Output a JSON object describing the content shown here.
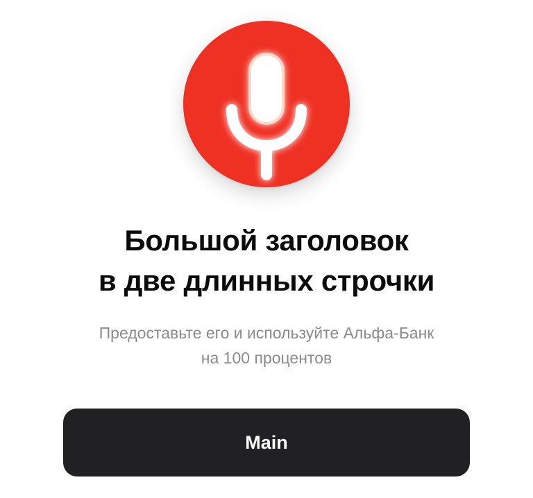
{
  "icon": {
    "name": "microphone-icon",
    "background_color": "#ef3124",
    "glyph_color": "#ffffff"
  },
  "title": {
    "line1": "Большой заголовок",
    "line2": "в две длинных строчки"
  },
  "subtitle": {
    "line1": "Предоставьте его и используйте Альфа-Банк",
    "line2": "на 100 процентов"
  },
  "button": {
    "label": "Main",
    "background_color": "#212124"
  }
}
